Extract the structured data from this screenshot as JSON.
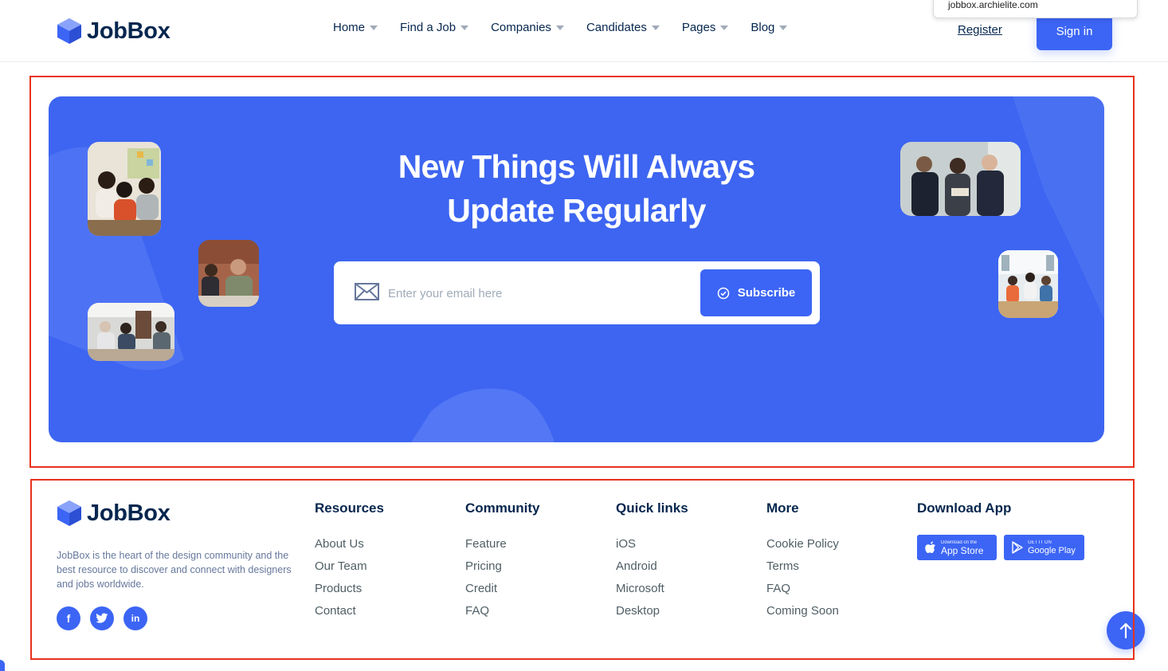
{
  "header": {
    "brand": "JobBox",
    "nav": [
      "Home",
      "Find a Job",
      "Companies",
      "Candidates",
      "Pages",
      "Blog"
    ],
    "register_label": "Register",
    "signin_label": "Sign in",
    "url_popup": "jobbox.archielite.com"
  },
  "newsletter": {
    "title_line1": "New Things Will Always",
    "title_line2": "Update Regularly",
    "email_placeholder": "Enter your email here",
    "subscribe_label": "Subscribe"
  },
  "footer": {
    "brand": "JobBox",
    "description": "JobBox is the heart of the design community and the best resource to discover and connect with designers and jobs worldwide.",
    "socials": [
      {
        "icon": "facebook-icon",
        "glyph": "f"
      },
      {
        "icon": "twitter-icon",
        "glyph": "t"
      },
      {
        "icon": "linkedin-icon",
        "glyph": "in"
      }
    ],
    "columns": [
      {
        "title": "Resources",
        "links": [
          "About Us",
          "Our Team",
          "Products",
          "Contact"
        ]
      },
      {
        "title": "Community",
        "links": [
          "Feature",
          "Pricing",
          "Credit",
          "FAQ"
        ]
      },
      {
        "title": "Quick links",
        "links": [
          "iOS",
          "Android",
          "Microsoft",
          "Desktop"
        ]
      },
      {
        "title": "More",
        "links": [
          "Cookie Policy",
          "Terms",
          "FAQ",
          "Coming Soon"
        ]
      }
    ],
    "download": {
      "title": "Download App",
      "app_store_small": "Download on the",
      "app_store_big": "App Store",
      "google_play_small": "GET IT ON",
      "google_play_big": "Google Play"
    }
  },
  "colors": {
    "primary": "#3c65f5",
    "banner": "#3d65f1",
    "heading": "#05264e",
    "annotation": "#e8321e"
  }
}
